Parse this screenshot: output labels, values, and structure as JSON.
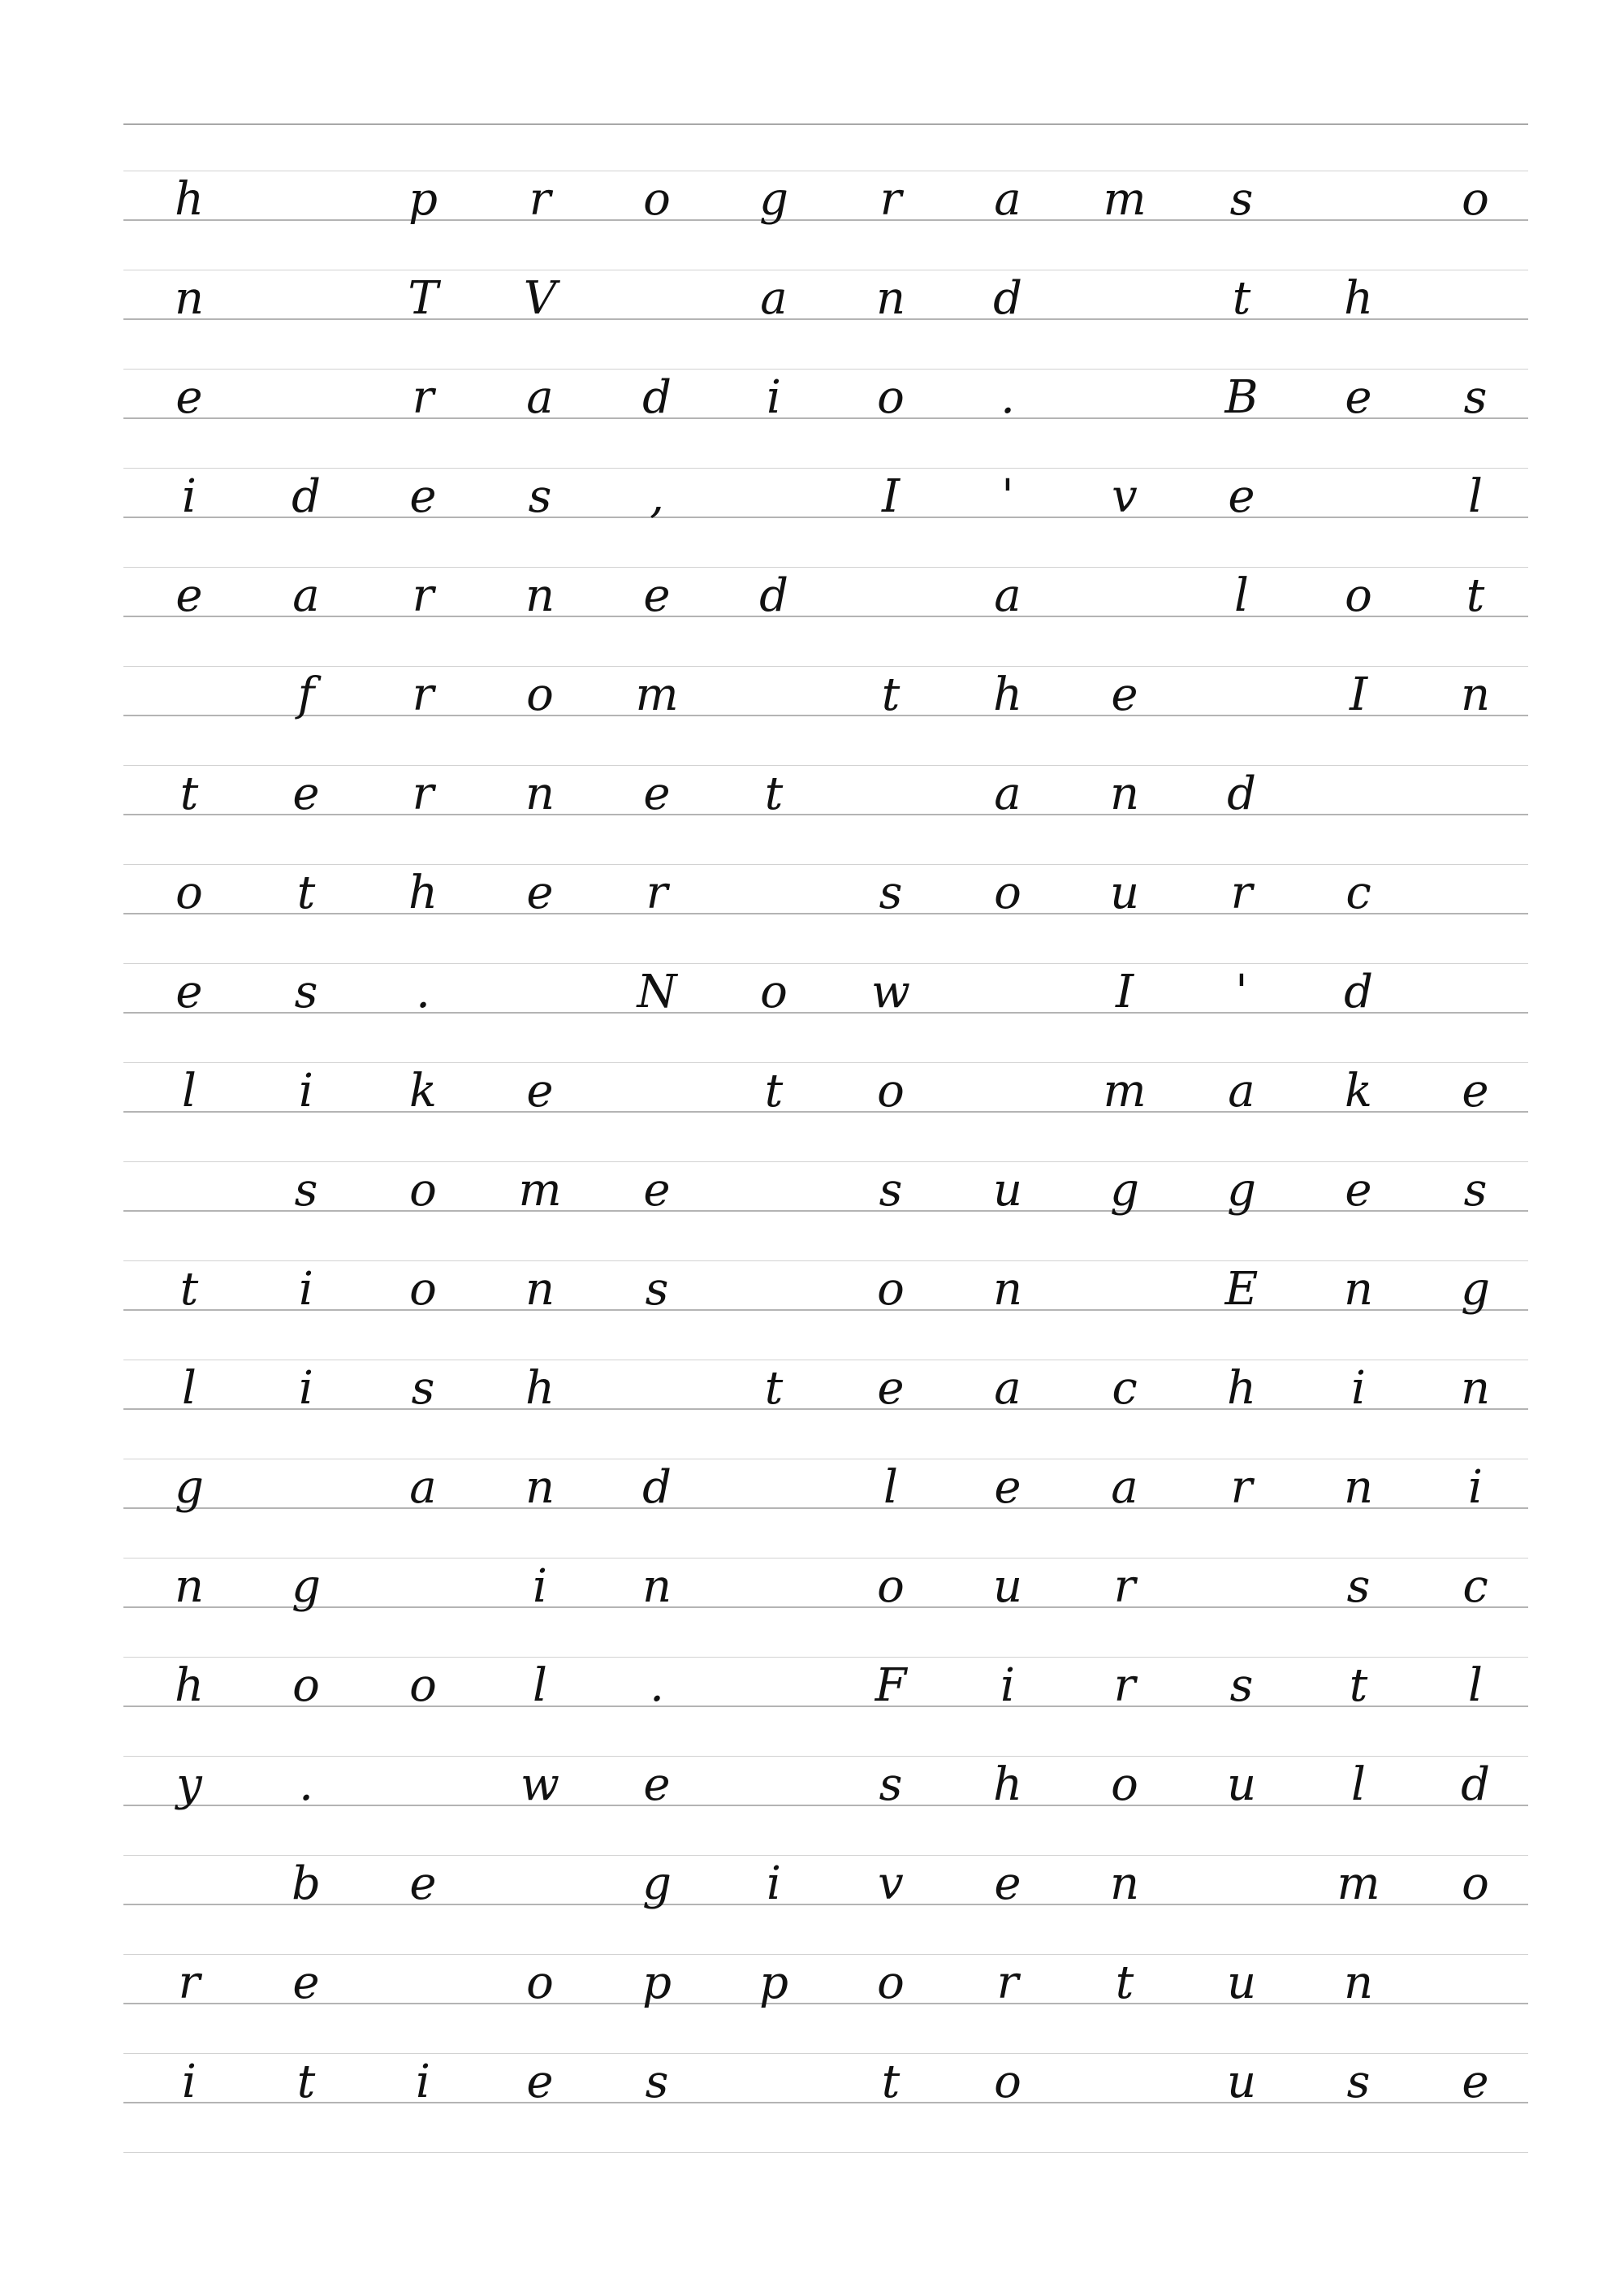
{
  "worksheet": {
    "rows": [
      [
        "h",
        "",
        "p",
        "r",
        "o",
        "g",
        "r",
        "a",
        "m",
        "s",
        "",
        "o"
      ],
      [
        "n",
        "",
        "T",
        "V",
        "",
        "a",
        "n",
        "d",
        "",
        "t",
        "h",
        ""
      ],
      [
        "e",
        "",
        "r",
        "a",
        "d",
        "i",
        "o",
        ".",
        "",
        "B",
        "e",
        "s"
      ],
      [
        "i",
        "d",
        "e",
        "s",
        ",",
        "",
        "I",
        "'",
        "v",
        "e",
        "",
        "l"
      ],
      [
        "e",
        "a",
        "r",
        "n",
        "e",
        "d",
        "",
        "a",
        "",
        "l",
        "o",
        "t"
      ],
      [
        "",
        "f",
        "r",
        "o",
        "m",
        "",
        "t",
        "h",
        "e",
        "",
        "I",
        "n"
      ],
      [
        "t",
        "e",
        "r",
        "n",
        "e",
        "t",
        "",
        "a",
        "n",
        "d",
        "",
        ""
      ],
      [
        "o",
        "t",
        "h",
        "e",
        "r",
        "",
        "s",
        "o",
        "u",
        "r",
        "c",
        ""
      ],
      [
        "e",
        "s",
        ".",
        "",
        "N",
        "o",
        "w",
        "",
        "I",
        "'",
        "d",
        ""
      ],
      [
        "l",
        "i",
        "k",
        "e",
        "",
        "t",
        "o",
        "",
        "m",
        "a",
        "k",
        "e"
      ],
      [
        "",
        "s",
        "o",
        "m",
        "e",
        "",
        "s",
        "u",
        "g",
        "g",
        "e",
        "s"
      ],
      [
        "t",
        "i",
        "o",
        "n",
        "s",
        "",
        "o",
        "n",
        "",
        "E",
        "n",
        "g"
      ],
      [
        "l",
        "i",
        "s",
        "h",
        "",
        "t",
        "e",
        "a",
        "c",
        "h",
        "i",
        "n"
      ],
      [
        "g",
        "",
        "a",
        "n",
        "d",
        "",
        "l",
        "e",
        "a",
        "r",
        "n",
        "i"
      ],
      [
        "n",
        "g",
        "",
        "i",
        "n",
        "",
        "o",
        "u",
        "r",
        "",
        "s",
        "c"
      ],
      [
        "h",
        "o",
        "o",
        "l",
        ".",
        "",
        "F",
        "i",
        "r",
        "s",
        "t",
        "l"
      ],
      [
        "y",
        ".",
        "",
        "w",
        "e",
        "",
        "s",
        "h",
        "o",
        "u",
        "l",
        "d"
      ],
      [
        "",
        "b",
        "e",
        "",
        "g",
        "i",
        "v",
        "e",
        "n",
        "",
        "m",
        "o"
      ],
      [
        "r",
        "e",
        "",
        "o",
        "p",
        "p",
        "o",
        "r",
        "t",
        "u",
        "n",
        ""
      ],
      [
        "i",
        "t",
        "i",
        "e",
        "s",
        "",
        "t",
        "o",
        "",
        "u",
        "s",
        "e"
      ]
    ]
  }
}
